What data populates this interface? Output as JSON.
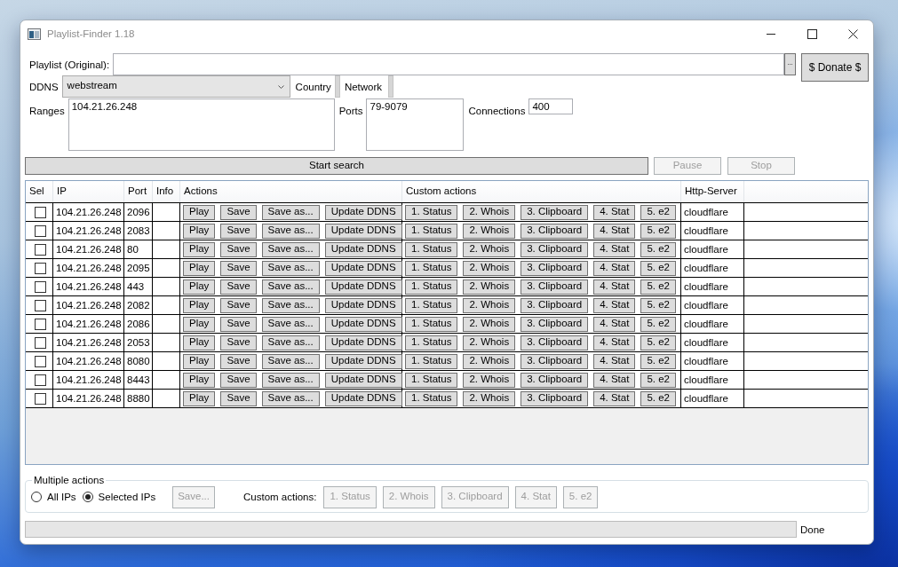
{
  "window": {
    "title": "Playlist-Finder 1.18"
  },
  "form": {
    "playlist": {
      "label": "Playlist (Original):",
      "browse_button": "..."
    },
    "donate_button": "$ Donate $",
    "ddns": {
      "label": "DDNS",
      "value": "webstream"
    },
    "country": {
      "label": "Country"
    },
    "network": {
      "label": "Network"
    },
    "ranges": {
      "label": "Ranges",
      "value": "104.21.26.248"
    },
    "ports": {
      "label": "Ports",
      "value": "79-9079"
    },
    "connections": {
      "label": "Connections",
      "value": "400"
    }
  },
  "search_buttons": [
    {
      "label": "Start search",
      "disabled": false
    },
    {
      "label": "Pause",
      "disabled": true
    },
    {
      "label": "Stop",
      "disabled": true
    }
  ],
  "table": {
    "columns": [
      "Sel",
      "IP",
      "Port",
      "Info",
      "Actions",
      "Custom actions",
      "Http-Server"
    ],
    "rows": [
      {
        "checked": false,
        "ip": "104.21.26.248",
        "port": "2096",
        "actions": [
          "Play",
          "Save",
          "Save as...",
          "Update DDNS"
        ],
        "custom_actions": [
          "1. Status",
          "2. Whois",
          "3. Clipboard",
          "4. Stat",
          "5. e2"
        ],
        "http_server": "cloudflare"
      },
      {
        "checked": false,
        "ip": "104.21.26.248",
        "port": "2083",
        "actions": [
          "Play",
          "Save",
          "Save as...",
          "Update DDNS"
        ],
        "custom_actions": [
          "1. Status",
          "2. Whois",
          "3. Clipboard",
          "4. Stat",
          "5. e2"
        ],
        "http_server": "cloudflare"
      },
      {
        "checked": false,
        "ip": "104.21.26.248",
        "port": "80",
        "actions": [
          "Play",
          "Save",
          "Save as...",
          "Update DDNS"
        ],
        "custom_actions": [
          "1. Status",
          "2. Whois",
          "3. Clipboard",
          "4. Stat",
          "5. e2"
        ],
        "http_server": "cloudflare"
      },
      {
        "checked": false,
        "ip": "104.21.26.248",
        "port": "2095",
        "actions": [
          "Play",
          "Save",
          "Save as...",
          "Update DDNS"
        ],
        "custom_actions": [
          "1. Status",
          "2. Whois",
          "3. Clipboard",
          "4. Stat",
          "5. e2"
        ],
        "http_server": "cloudflare"
      },
      {
        "checked": false,
        "ip": "104.21.26.248",
        "port": "443",
        "actions": [
          "Play",
          "Save",
          "Save as...",
          "Update DDNS"
        ],
        "custom_actions": [
          "1. Status",
          "2. Whois",
          "3. Clipboard",
          "4. Stat",
          "5. e2"
        ],
        "http_server": "cloudflare"
      },
      {
        "checked": false,
        "ip": "104.21.26.248",
        "port": "2082",
        "actions": [
          "Play",
          "Save",
          "Save as...",
          "Update DDNS"
        ],
        "custom_actions": [
          "1. Status",
          "2. Whois",
          "3. Clipboard",
          "4. Stat",
          "5. e2"
        ],
        "http_server": "cloudflare"
      },
      {
        "checked": false,
        "ip": "104.21.26.248",
        "port": "2086",
        "actions": [
          "Play",
          "Save",
          "Save as...",
          "Update DDNS"
        ],
        "custom_actions": [
          "1. Status",
          "2. Whois",
          "3. Clipboard",
          "4. Stat",
          "5. e2"
        ],
        "http_server": "cloudflare"
      },
      {
        "checked": false,
        "ip": "104.21.26.248",
        "port": "2053",
        "actions": [
          "Play",
          "Save",
          "Save as...",
          "Update DDNS"
        ],
        "custom_actions": [
          "1. Status",
          "2. Whois",
          "3. Clipboard",
          "4. Stat",
          "5. e2"
        ],
        "http_server": "cloudflare"
      },
      {
        "checked": false,
        "ip": "104.21.26.248",
        "port": "8080",
        "actions": [
          "Play",
          "Save",
          "Save as...",
          "Update DDNS"
        ],
        "custom_actions": [
          "1. Status",
          "2. Whois",
          "3. Clipboard",
          "4. Stat",
          "5. e2"
        ],
        "http_server": "cloudflare"
      },
      {
        "checked": false,
        "ip": "104.21.26.248",
        "port": "8443",
        "actions": [
          "Play",
          "Save",
          "Save as...",
          "Update DDNS"
        ],
        "custom_actions": [
          "1. Status",
          "2. Whois",
          "3. Clipboard",
          "4. Stat",
          "5. e2"
        ],
        "http_server": "cloudflare"
      },
      {
        "checked": false,
        "ip": "104.21.26.248",
        "port": "8880",
        "actions": [
          "Play",
          "Save",
          "Save as...",
          "Update DDNS"
        ],
        "custom_actions": [
          "1. Status",
          "2. Whois",
          "3. Clipboard",
          "4. Stat",
          "5. e2"
        ],
        "http_server": "cloudflare"
      }
    ]
  },
  "multiple_actions": {
    "title": "Multiple actions",
    "scope": [
      {
        "label": "All IPs",
        "selected": false
      },
      {
        "label": "Selected IPs",
        "selected": true
      }
    ],
    "save_button": {
      "label": "Save...",
      "disabled": true
    },
    "custom_label": "Custom actions:",
    "custom_buttons": [
      {
        "label": "1. Status",
        "disabled": true
      },
      {
        "label": "2. Whois",
        "disabled": true
      },
      {
        "label": "3. Clipboard",
        "disabled": true
      },
      {
        "label": "4. Stat",
        "disabled": true
      },
      {
        "label": "5. e2",
        "disabled": true
      }
    ]
  },
  "status_bar": {
    "progress": {
      "level": 0
    },
    "text": "Done"
  }
}
